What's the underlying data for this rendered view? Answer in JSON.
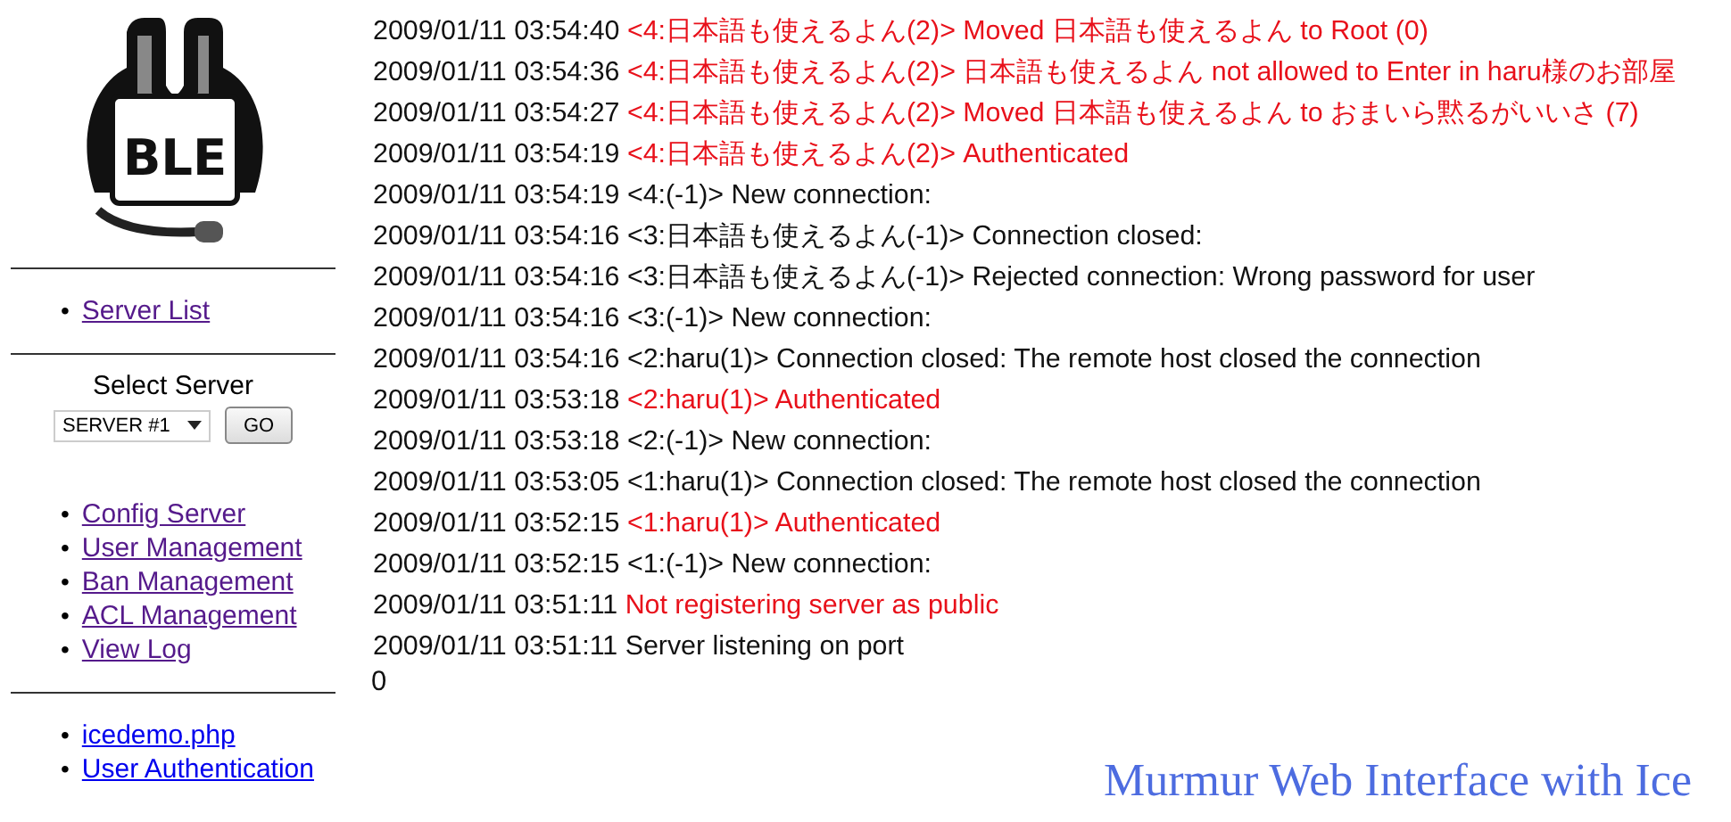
{
  "logo": {
    "text": "BLE"
  },
  "sidebar": {
    "bullet": "•",
    "sections": [
      {
        "kind": "links",
        "links": [
          {
            "label": "Server List",
            "visited": true
          }
        ]
      },
      {
        "kind": "select",
        "label": "Select Server",
        "select_value": "SERVER #1",
        "button": "GO"
      },
      {
        "kind": "links",
        "links": [
          {
            "label": "Config Server",
            "visited": true
          },
          {
            "label": "User Management",
            "visited": true
          },
          {
            "label": "Ban Management",
            "visited": true
          },
          {
            "label": "ACL Management",
            "visited": true
          },
          {
            "label": "View Log",
            "visited": true
          }
        ]
      },
      {
        "kind": "links",
        "links": [
          {
            "label": "icedemo.php",
            "visited": false
          },
          {
            "label": "User Authentication",
            "visited": false
          }
        ]
      }
    ]
  },
  "log": [
    {
      "time": "2009/01/11 03:54:40",
      "message": "<4:日本語も使えるよん(2)> Moved 日本語も使えるよん to Root (0)",
      "highlighted": true
    },
    {
      "time": "2009/01/11 03:54:36",
      "message": "<4:日本語も使えるよん(2)> 日本語も使えるよん not allowed to Enter in haru様のお部屋",
      "highlighted": true
    },
    {
      "time": "2009/01/11 03:54:27",
      "message": "<4:日本語も使えるよん(2)> Moved 日本語も使えるよん to おまいら黙るがいいさ (7)",
      "highlighted": true
    },
    {
      "time": "2009/01/11 03:54:19",
      "message": "<4:日本語も使えるよん(2)> Authenticated",
      "highlighted": true
    },
    {
      "time": "2009/01/11 03:54:19",
      "message": "<4:(-1)> New connection:",
      "highlighted": false
    },
    {
      "time": "2009/01/11 03:54:16",
      "message": "<3:日本語も使えるよん(-1)> Connection closed:",
      "highlighted": false
    },
    {
      "time": "2009/01/11 03:54:16",
      "message": "<3:日本語も使えるよん(-1)> Rejected connection: Wrong password for user",
      "highlighted": false
    },
    {
      "time": "2009/01/11 03:54:16",
      "message": "<3:(-1)> New connection:",
      "highlighted": false
    },
    {
      "time": "2009/01/11 03:54:16",
      "message": "<2:haru(1)> Connection closed: The remote host closed the connection",
      "highlighted": false
    },
    {
      "time": "2009/01/11 03:53:18",
      "message": "<2:haru(1)> Authenticated",
      "highlighted": true
    },
    {
      "time": "2009/01/11 03:53:18",
      "message": "<2:(-1)> New connection:",
      "highlighted": false
    },
    {
      "time": "2009/01/11 03:53:05",
      "message": "<1:haru(1)> Connection closed: The remote host closed the connection",
      "highlighted": false
    },
    {
      "time": "2009/01/11 03:52:15",
      "message": "<1:haru(1)> Authenticated",
      "highlighted": true
    },
    {
      "time": "2009/01/11 03:52:15",
      "message": "<1:(-1)> New connection:",
      "highlighted": false
    },
    {
      "time": "2009/01/11 03:51:11",
      "message": "Not registering server as public",
      "highlighted": true
    },
    {
      "time": "2009/01/11 03:51:11",
      "message": "Server listening on port",
      "highlighted": false
    }
  ],
  "log_trailer": "0",
  "footer_title": "Murmur Web Interface with Ice"
}
